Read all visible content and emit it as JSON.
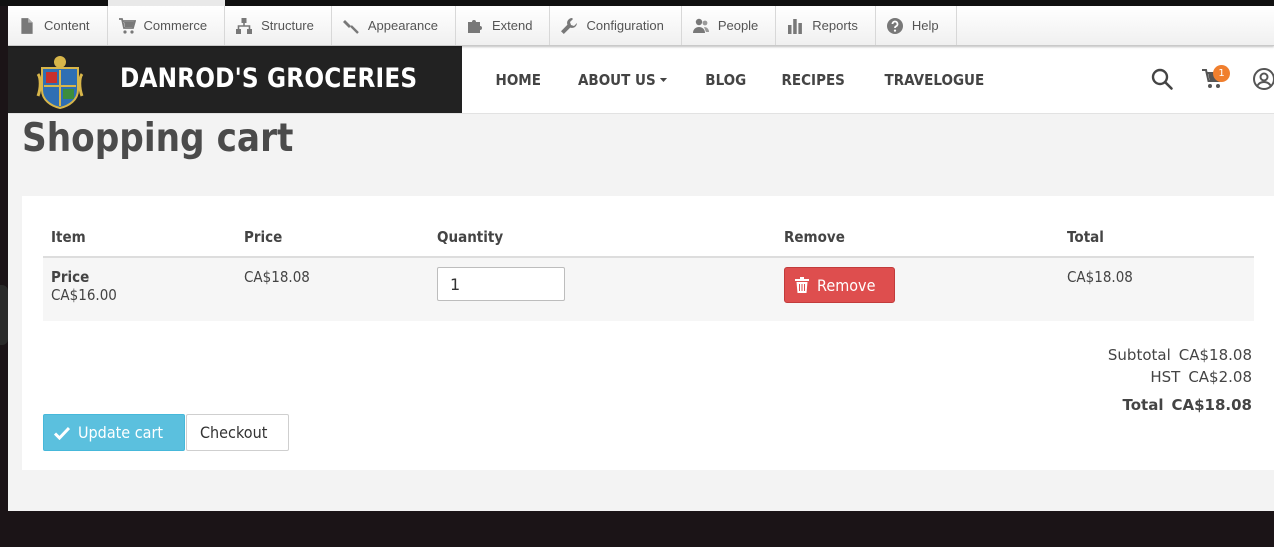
{
  "toolbar": {
    "items": [
      {
        "label": "Content",
        "icon": "document-icon"
      },
      {
        "label": "Commerce",
        "icon": "cart-icon"
      },
      {
        "label": "Structure",
        "icon": "sitemap-icon"
      },
      {
        "label": "Appearance",
        "icon": "paintbrush-icon"
      },
      {
        "label": "Extend",
        "icon": "puzzle-icon"
      },
      {
        "label": "Configuration",
        "icon": "wrench-icon"
      },
      {
        "label": "People",
        "icon": "people-icon"
      },
      {
        "label": "Reports",
        "icon": "bar-chart-icon"
      },
      {
        "label": "Help",
        "icon": "help-icon"
      }
    ]
  },
  "header": {
    "site_name": "DANROD'S GROCERIES",
    "nav": [
      {
        "label": "HOME"
      },
      {
        "label": "ABOUT US",
        "has_dropdown": true
      },
      {
        "label": "BLOG"
      },
      {
        "label": "RECIPES"
      },
      {
        "label": "TRAVELOGUE"
      }
    ],
    "cart_count": "1"
  },
  "page": {
    "title": "Shopping cart"
  },
  "cart": {
    "columns": [
      "Item",
      "Price",
      "Quantity",
      "Remove",
      "Total"
    ],
    "rows": [
      {
        "item_title": "Price",
        "item_price": "CA$16.00",
        "price": "CA$18.08",
        "quantity": "1",
        "remove_label": "Remove",
        "total": "CA$18.08"
      }
    ],
    "subtotal_label": "Subtotal",
    "subtotal": "CA$18.08",
    "tax_label": "HST",
    "tax": "CA$2.08",
    "total_label": "Total",
    "total": "CA$18.08",
    "update_label": "Update cart",
    "checkout_label": "Checkout"
  },
  "colors": {
    "brand_bg": "#222222",
    "remove_button": "#de4e4e",
    "update_button": "#5bc0de",
    "cart_badge": "#f07f2e"
  }
}
